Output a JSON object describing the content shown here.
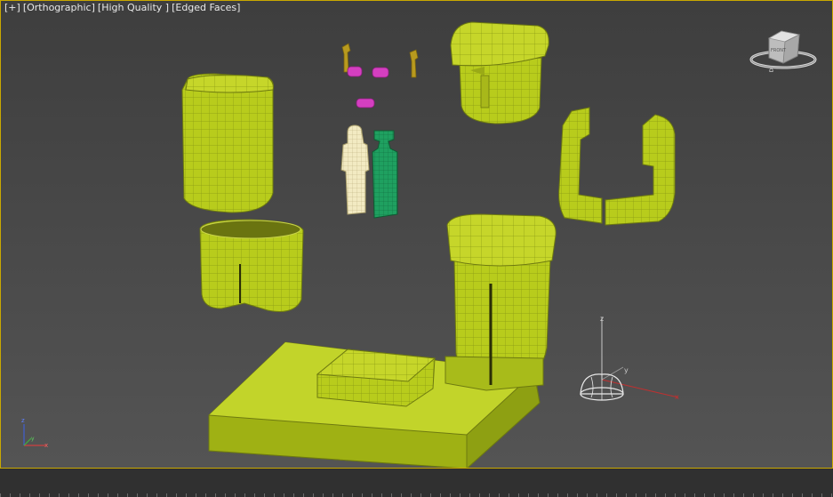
{
  "viewport": {
    "menu_plus": "[+]",
    "menu_view": "[Orthographic]",
    "menu_shading": "[High Quality ]",
    "menu_display": "[Edged Faces]"
  },
  "viewcube": {
    "face_label": "FRONT"
  },
  "colors": {
    "mesh": "#b8cc1c",
    "mesh_dark": "#8ea012",
    "wire": "#6e7a10",
    "selection_border": "#c9a800",
    "magenta": "#d43fc0",
    "green_figure": "#1fa060",
    "cream_figure": "#f2eac2",
    "gold": "#b89a1e"
  },
  "gizmo_icon": "move-transform-gizmo-icon",
  "axis_icon": "world-axis-tripod-icon"
}
